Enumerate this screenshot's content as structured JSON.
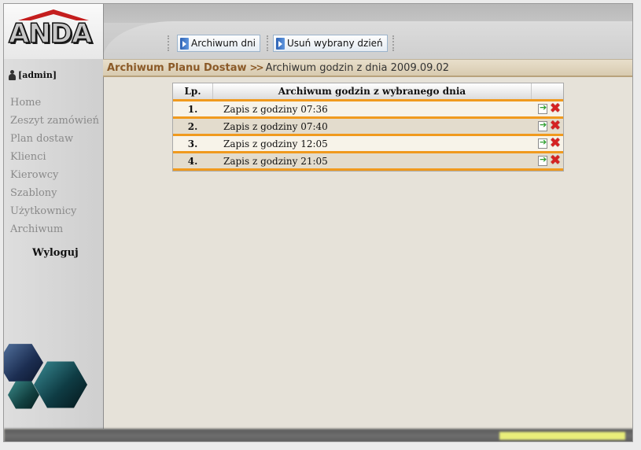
{
  "logo": {
    "text": "ANDA"
  },
  "user": {
    "name": "[admin]"
  },
  "nav": {
    "items": [
      {
        "label": "Home"
      },
      {
        "label": "Zeszyt zamówień"
      },
      {
        "label": "Plan dostaw"
      },
      {
        "label": "Klienci"
      },
      {
        "label": "Kierowcy"
      },
      {
        "label": "Szablony"
      },
      {
        "label": "Użytkownicy"
      },
      {
        "label": "Archiwum"
      }
    ],
    "logout": "Wyloguj"
  },
  "toolbar": {
    "archive_days": "Archiwum dni",
    "delete_day": "Usuń wybrany dzień"
  },
  "breadcrumb": {
    "parent": "Archiwum Planu Dostaw",
    "separator": ">>",
    "current": "Archiwum godzin z dnia 2009.09.02"
  },
  "table": {
    "col_lp": "Lp.",
    "col_desc": "Archiwum godzin z wybranego dnia",
    "rows": [
      {
        "lp": "1.",
        "desc": "Zapis z godziny 07:36"
      },
      {
        "lp": "2.",
        "desc": "Zapis z godziny 07:40"
      },
      {
        "lp": "3.",
        "desc": "Zapis z godziny 12:05"
      },
      {
        "lp": "4.",
        "desc": "Zapis z godziny 21:05"
      }
    ]
  },
  "icons": {
    "user": "user-icon",
    "toolbar_button": "arrow-right-icon",
    "open": "open-file-icon",
    "delete": "delete-x-icon"
  },
  "colors": {
    "accent_orange": "#f09a1e",
    "breadcrumb_text": "#8b5a28",
    "delete_red": "#d62222",
    "open_green": "#2d9e2d",
    "logo_red": "#c41e1e"
  }
}
